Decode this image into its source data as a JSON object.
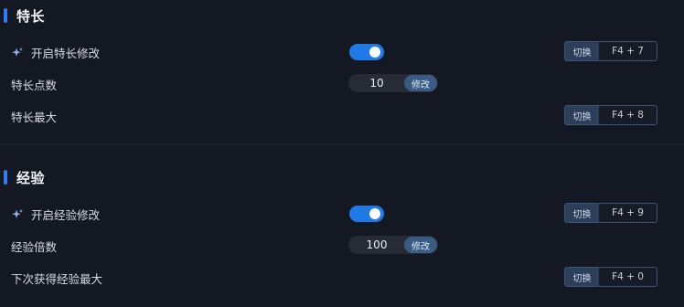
{
  "sections": [
    {
      "title": "特长",
      "rows": [
        {
          "label": "开启特长修改",
          "toggle_on": true,
          "hotkey_switch": "切换",
          "hotkey": "F4 + 7"
        },
        {
          "label": "特长点数",
          "value": "10",
          "button": "修改"
        },
        {
          "label": "特长最大",
          "hotkey_switch": "切换",
          "hotkey": "F4 + 8"
        }
      ]
    },
    {
      "title": "经验",
      "rows": [
        {
          "label": "开启经验修改",
          "toggle_on": true,
          "hotkey_switch": "切换",
          "hotkey": "F4 + 9"
        },
        {
          "label": "经验倍数",
          "value": "100",
          "button": "修改"
        },
        {
          "label": "下次获得经验最大",
          "hotkey_switch": "切换",
          "hotkey": "F4 + 0"
        }
      ]
    }
  ],
  "icons": {
    "toggle_row_icon": "sparkle-icon"
  },
  "colors": {
    "accent": "#2f7df6",
    "toggle_on": "#1f7ae8",
    "background": "#141822"
  }
}
